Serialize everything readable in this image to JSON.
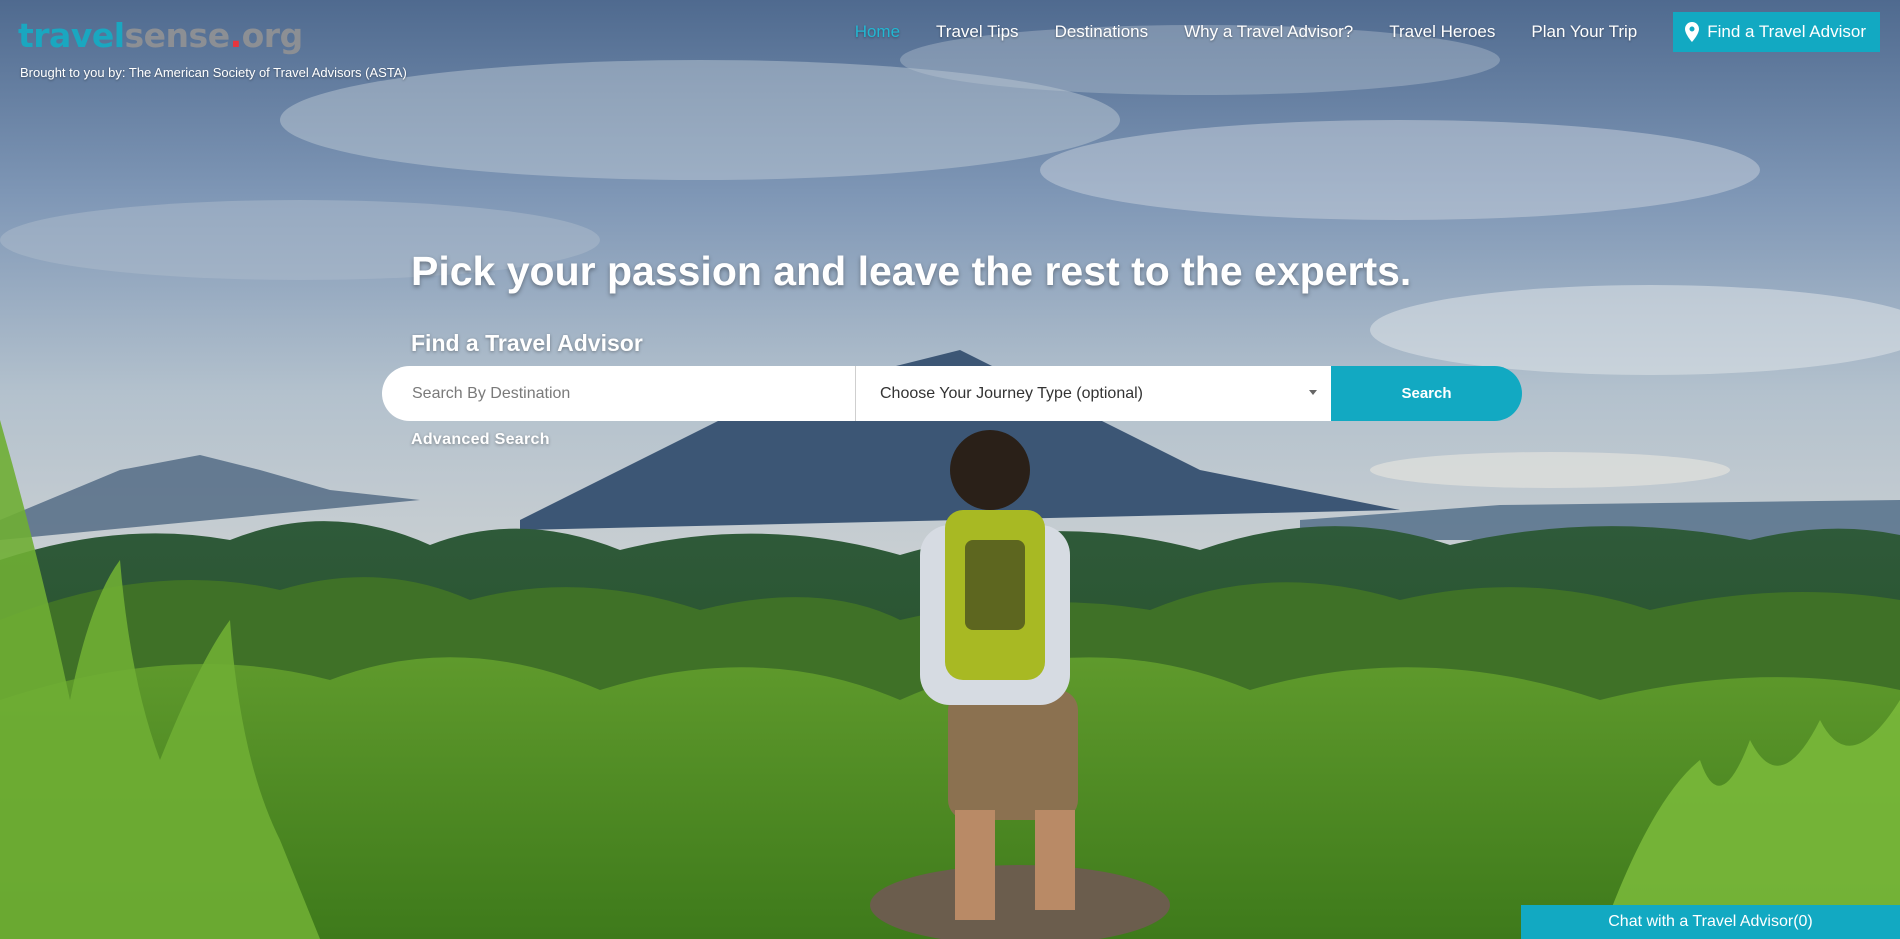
{
  "brand": {
    "logo_part1": "travel",
    "logo_part2": "sense",
    "logo_dot": ".",
    "logo_part3": "org",
    "tagline": "Brought to you by: The American Society of Travel Advisors (ASTA)"
  },
  "nav": {
    "items": [
      {
        "label": "Home"
      },
      {
        "label": "Travel Tips"
      },
      {
        "label": "Destinations"
      },
      {
        "label": "Why a Travel Advisor?"
      },
      {
        "label": "Travel Heroes"
      },
      {
        "label": "Plan Your Trip"
      }
    ],
    "cta_label": "Find a Travel Advisor",
    "active_color": "#22b7d2"
  },
  "hero": {
    "headline": "Pick your passion and leave the rest to the experts.",
    "subhead": "Find a Travel Advisor"
  },
  "search": {
    "destination_placeholder": "Search By Destination",
    "journey_selected": "Choose Your Journey Type (optional)",
    "button_label": "Search",
    "advanced_label": "Advanced Search"
  },
  "chat": {
    "label": "Chat with a Travel Advisor(0)"
  },
  "colors": {
    "accent": "#12a9c2",
    "logo_grey": "#8c8f94",
    "logo_dot": "#e8353d"
  }
}
